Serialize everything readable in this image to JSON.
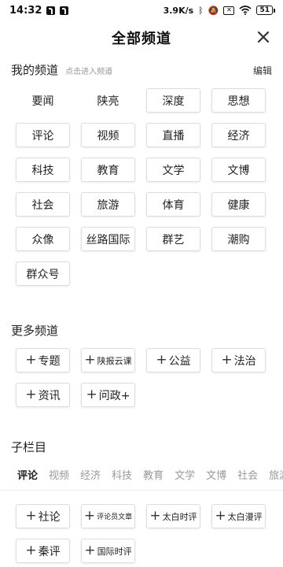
{
  "statusbar": {
    "time": "14:32",
    "speed": "3.9K/s",
    "battery": "51"
  },
  "header": {
    "title": "全部频道"
  },
  "my_channels": {
    "title": "我的频道",
    "hint": "点击进入频道",
    "edit_label": "编辑",
    "items": [
      {
        "label": "要闻",
        "boxed": false
      },
      {
        "label": "陕亮",
        "boxed": false
      },
      {
        "label": "深度",
        "boxed": true
      },
      {
        "label": "思想",
        "boxed": true
      },
      {
        "label": "评论",
        "boxed": true
      },
      {
        "label": "视频",
        "boxed": true
      },
      {
        "label": "直播",
        "boxed": true
      },
      {
        "label": "经济",
        "boxed": true
      },
      {
        "label": "科技",
        "boxed": true
      },
      {
        "label": "教育",
        "boxed": true
      },
      {
        "label": "文学",
        "boxed": true
      },
      {
        "label": "文博",
        "boxed": true
      },
      {
        "label": "社会",
        "boxed": true
      },
      {
        "label": "旅游",
        "boxed": true
      },
      {
        "label": "体育",
        "boxed": true
      },
      {
        "label": "健康",
        "boxed": true
      },
      {
        "label": "众像",
        "boxed": true
      },
      {
        "label": "丝路国际",
        "boxed": true
      },
      {
        "label": "群艺",
        "boxed": true
      },
      {
        "label": "潮购",
        "boxed": true
      },
      {
        "label": "群众号",
        "boxed": true
      }
    ]
  },
  "more_channels": {
    "title": "更多频道",
    "items": [
      {
        "label": "专题"
      },
      {
        "label": "陕报云课"
      },
      {
        "label": "公益"
      },
      {
        "label": "法治"
      },
      {
        "label": "资讯"
      },
      {
        "label": "问政+"
      }
    ]
  },
  "sub_columns": {
    "title": "子栏目",
    "tabs": [
      "评论",
      "视频",
      "经济",
      "科技",
      "教育",
      "文学",
      "文博",
      "社会",
      "旅游"
    ],
    "items": [
      {
        "label": "社论"
      },
      {
        "label": "评论员文章"
      },
      {
        "label": "太白时评"
      },
      {
        "label": "太白漫评"
      },
      {
        "label": "秦评"
      },
      {
        "label": "国际时评"
      }
    ]
  },
  "colors": {
    "accent": "#d0021b",
    "chip_border": "#dddddd",
    "muted": "#999999"
  }
}
